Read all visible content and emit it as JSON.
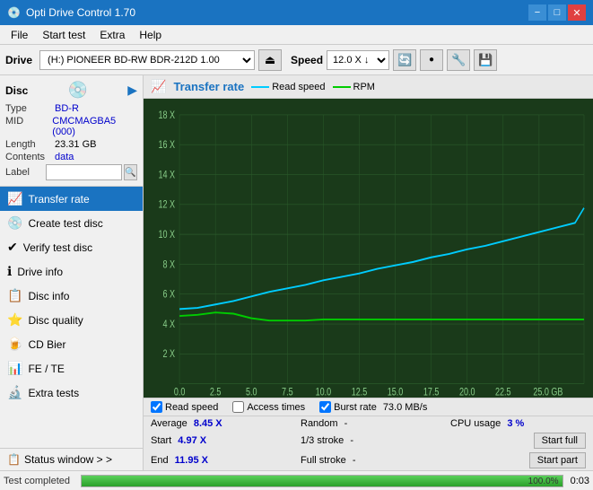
{
  "app": {
    "title": "Opti Drive Control 1.70",
    "icon": "💿"
  },
  "title_controls": {
    "minimize": "−",
    "maximize": "□",
    "close": "✕"
  },
  "menu": {
    "items": [
      "File",
      "Start test",
      "Extra",
      "Help"
    ]
  },
  "toolbar": {
    "drive_label": "Drive",
    "drive_value": "(H:)  PIONEER BD-RW   BDR-212D 1.00",
    "eject_icon": "⏏",
    "speed_label": "Speed",
    "speed_value": "12.0 X ↓",
    "icon1": "🔄",
    "icon2": "🔴",
    "icon3": "🔧",
    "icon4": "💾"
  },
  "disc": {
    "title": "Disc",
    "type_label": "Type",
    "type_value": "BD-R",
    "mid_label": "MID",
    "mid_value": "CMCMAGBA5 (000)",
    "length_label": "Length",
    "length_value": "23.31 GB",
    "contents_label": "Contents",
    "contents_value": "data",
    "label_label": "Label",
    "label_placeholder": ""
  },
  "nav": {
    "items": [
      {
        "id": "transfer-rate",
        "label": "Transfer rate",
        "icon": "📈",
        "active": true
      },
      {
        "id": "create-test-disc",
        "label": "Create test disc",
        "icon": "💿"
      },
      {
        "id": "verify-test-disc",
        "label": "Verify test disc",
        "icon": "✔️"
      },
      {
        "id": "drive-info",
        "label": "Drive info",
        "icon": "ℹ️"
      },
      {
        "id": "disc-info",
        "label": "Disc info",
        "icon": "📋"
      },
      {
        "id": "disc-quality",
        "label": "Disc quality",
        "icon": "⭐"
      },
      {
        "id": "cd-bier",
        "label": "CD Bier",
        "icon": "🍺"
      },
      {
        "id": "fe-te",
        "label": "FE / TE",
        "icon": "📊"
      },
      {
        "id": "extra-tests",
        "label": "Extra tests",
        "icon": "🔬"
      }
    ],
    "status_window": "Status window > >"
  },
  "chart": {
    "title": "Transfer rate",
    "legend": [
      {
        "id": "read-speed",
        "label": "Read speed",
        "color": "#00ccff"
      },
      {
        "id": "rpm",
        "label": "RPM",
        "color": "#00cc00"
      }
    ],
    "y_axis": [
      "18 X",
      "16 X",
      "14 X",
      "12 X",
      "10 X",
      "8 X",
      "6 X",
      "4 X",
      "2 X"
    ],
    "x_axis": [
      "0.0",
      "2.5",
      "5.0",
      "7.5",
      "10.0",
      "12.5",
      "15.0",
      "17.5",
      "20.0",
      "22.5",
      "25.0 GB"
    ]
  },
  "checkboxes": [
    {
      "id": "read-speed-cb",
      "label": "Read speed",
      "checked": true
    },
    {
      "id": "access-times-cb",
      "label": "Access times",
      "checked": false
    },
    {
      "id": "burst-rate-cb",
      "label": "Burst rate",
      "checked": true,
      "value": "73.0 MB/s"
    }
  ],
  "stats": {
    "rows": [
      {
        "col1_label": "Average",
        "col1_value": "8.45 X",
        "col2_label": "Random",
        "col2_value": "-",
        "col3_label": "CPU usage",
        "col3_value": "3 %",
        "col3_action": null
      },
      {
        "col1_label": "Start",
        "col1_value": "4.97 X",
        "col2_label": "1/3 stroke",
        "col2_value": "-",
        "col3_label": "",
        "col3_value": "",
        "col3_action": "Start full"
      },
      {
        "col1_label": "End",
        "col1_value": "11.95 X",
        "col2_label": "Full stroke",
        "col2_value": "-",
        "col3_label": "",
        "col3_value": "",
        "col3_action": "Start part"
      }
    ]
  },
  "status_bar": {
    "text": "Test completed",
    "progress": 100,
    "progress_pct": "100.0%",
    "time": "0:03"
  }
}
